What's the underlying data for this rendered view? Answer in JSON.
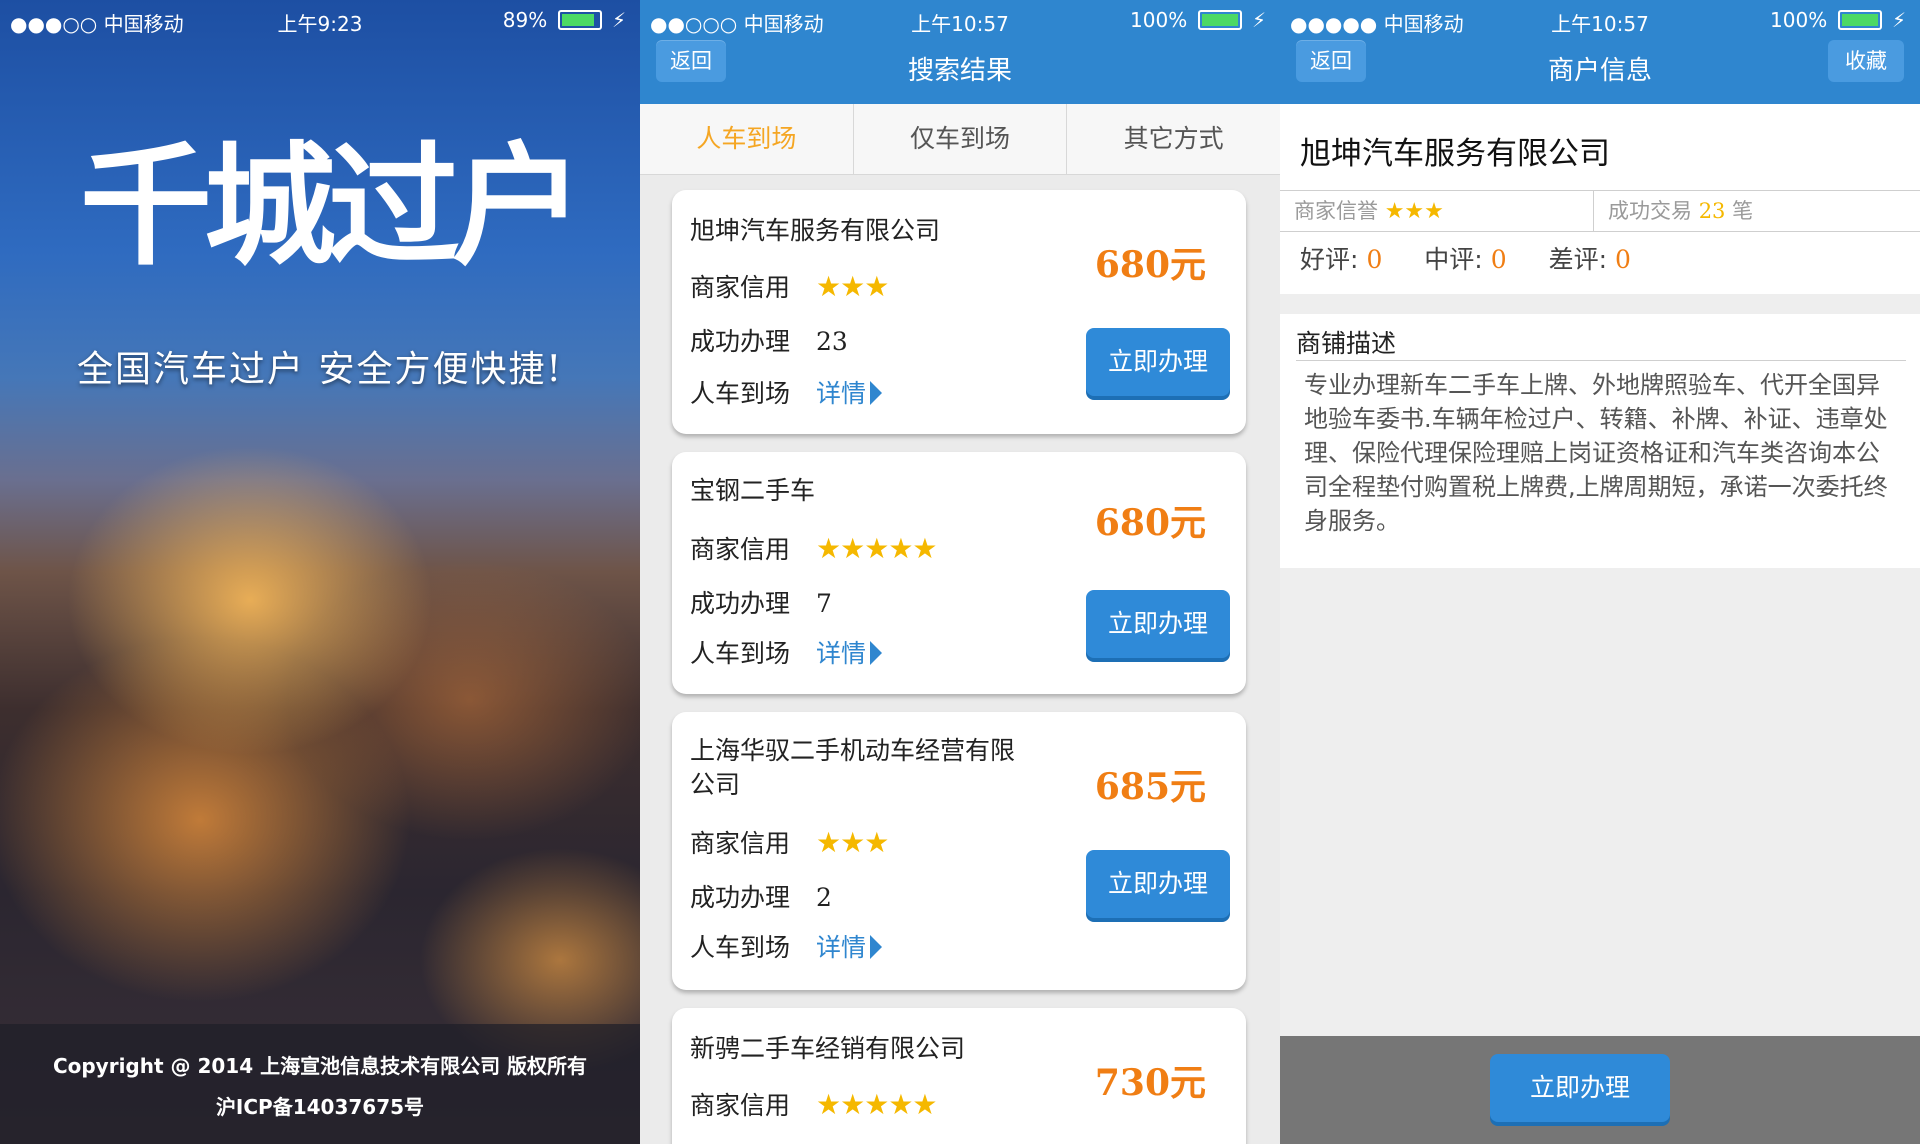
{
  "splash": {
    "status": {
      "carrier": "●●●○○ 中国移动",
      "time": "上午9:23",
      "battery": "89%",
      "battery_level": 0.89
    },
    "logo_text": "千城过户",
    "slogan": "全国汽车过户 安全方便快捷!",
    "copyright": "Copyright @ 2014 上海宣池信息技术有限公司 版权所有",
    "icp": "沪ICP备14037675号"
  },
  "results": {
    "status": {
      "carrier": "●●○○○ 中国移动",
      "time": "上午10:57",
      "battery": "100%",
      "battery_level": 1.0
    },
    "back": "返回",
    "title": "搜索结果",
    "tabs": [
      "人车到场",
      "仅车到场",
      "其它方式"
    ],
    "credit_label": "商家信用",
    "success_label": "成功办理",
    "mode_label": "人车到场",
    "detail_label": "详情",
    "go_label": "立即办理",
    "items": [
      {
        "name": "旭坤汽车服务有限公司",
        "stars": "★★★",
        "count": "23",
        "price": "680元"
      },
      {
        "name": "宝钢二手车",
        "stars": "★★★★★",
        "count": "7",
        "price": "680元"
      },
      {
        "name": "上海华驭二手机动车经营有限公司",
        "stars": "★★★",
        "count": "2",
        "price": "685元"
      },
      {
        "name": "新骋二手车经销有限公司",
        "stars": "★★★★★",
        "count": "",
        "price": "730元"
      }
    ]
  },
  "merchant": {
    "status": {
      "carrier": "●●●●● 中国移动",
      "time": "上午10:57",
      "battery": "100%",
      "battery_level": 1.0
    },
    "back": "返回",
    "title": "商户信息",
    "favorite": "收藏",
    "name": "旭坤汽车服务有限公司",
    "credit_label": "商家信誉",
    "credit_stars": "★★★",
    "trade_label": "成功交易",
    "trade_count": "23",
    "trade_unit": "笔",
    "reviews": [
      {
        "label": "好评:",
        "value": "0"
      },
      {
        "label": "中评:",
        "value": "0"
      },
      {
        "label": "差评:",
        "value": "0"
      }
    ],
    "desc_title": "商铺描述",
    "desc_text": "专业办理新车二手车上牌、外地牌照验车、代开全国异地验车委书.车辆年检过户、转籍、补牌、补证、违章处理、保险代理保险理赔上岗证资格证和汽车类咨询本公司全程垫付购置税上牌费,上牌周期短，承诺一次委托终身服务。",
    "go_label": "立即办理"
  }
}
